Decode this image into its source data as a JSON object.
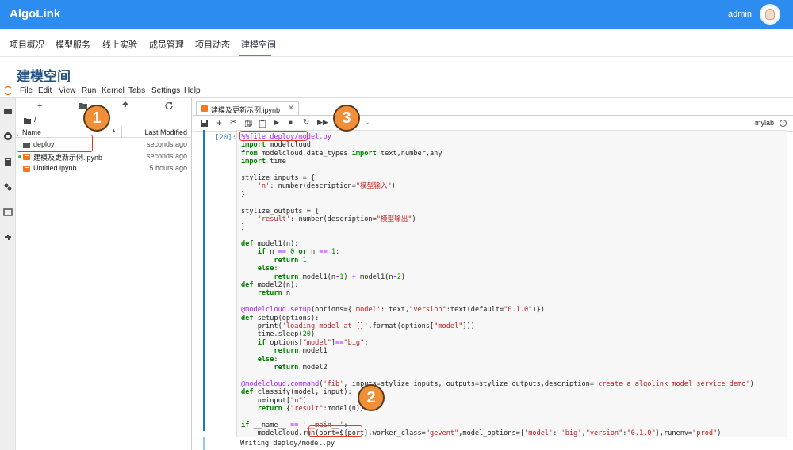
{
  "app": {
    "brand": "AlgoLink",
    "user": "admin"
  },
  "nav": {
    "tabs": [
      "项目概况",
      "模型服务",
      "线上实验",
      "成员管理",
      "项目动态",
      "建模空间"
    ],
    "active_index": 5
  },
  "page_title": "建模空间",
  "jupyter": {
    "menus": [
      "File",
      "Edit",
      "View",
      "Run",
      "Kernel",
      "Tabs",
      "Settings",
      "Help"
    ]
  },
  "file_browser": {
    "path": "/",
    "columns": {
      "name": "Name",
      "modified": "Last Modified"
    },
    "items": [
      {
        "name": "deploy",
        "modified": "seconds ago",
        "type": "folder",
        "running": false
      },
      {
        "name": "建模及更新示例.ipynb",
        "modified": "seconds ago",
        "type": "notebook",
        "running": true
      },
      {
        "name": "Untitled.ipynb",
        "modified": "5 hours ago",
        "type": "notebook",
        "running": false
      }
    ]
  },
  "notebook": {
    "tab_label": "建模及更新示例.ipynb",
    "tab_close": "×",
    "kernel_name": "mylab",
    "prompt": "[20]:",
    "output": "Writing deploy/model.py",
    "code_lines": [
      "%%file deploy/model.py",
      "import modelcloud",
      "from modelcloud.data_types import text,number,any",
      "import time",
      "",
      "stylize_inputs = {",
      "    'n': number(description=\"模型输入\")",
      "}",
      "",
      "stylize_outputs = {",
      "    'result': number(description=\"模型输出\")",
      "}",
      "",
      "def model1(n):",
      "    if n == 0 or n == 1:",
      "        return 1",
      "    else:",
      "        return model1(n-1) + model1(n-2)",
      "def model2(n):",
      "    return n",
      "",
      "@modelcloud.setup(options={'model': text,\"version\":text(default=\"0.1.0\")})",
      "def setup(options):",
      "    print('loading model at {}'.format(options[\"model\"]))",
      "    time.sleep(20)",
      "    if options[\"model\"]==\"big\":",
      "        return model1",
      "    else:",
      "        return model2",
      "",
      "@modelcloud.command('fib', inputs=stylize_inputs, outputs=stylize_outputs,description='create a algolink model service demo')",
      "def classify(model, input):",
      "    n=input[\"n\"]",
      "    return {\"result\":model(n)}",
      "",
      "if __name__ == '__main__':",
      "    modelcloud.run(port=${port},worker_class=\"gevent\",model_options={'model': 'big',\"version\":\"0.1.0\"},runenv=\"prod\")"
    ]
  },
  "callouts": [
    "1",
    "2",
    "3"
  ],
  "colors": {
    "topbar": "#2d8cf0",
    "highlight": "#e03a2c",
    "callout": "#f08f38"
  }
}
